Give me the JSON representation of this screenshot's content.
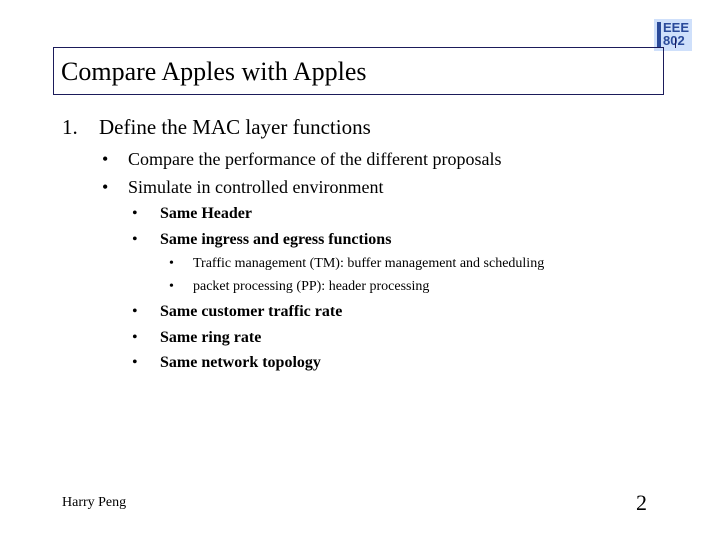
{
  "logo": {
    "line1": "EEE",
    "line2": "802",
    "color": "#2a4a9a",
    "background": "#cfe0fb"
  },
  "title": "Compare Apples with Apples",
  "outline": {
    "number": "1.",
    "heading": "Define the MAC layer functions",
    "bullets": [
      {
        "text": "Compare the performance of the different proposals"
      },
      {
        "text": "Simulate in controlled environment"
      }
    ],
    "sub_bullets": [
      {
        "text": "Same Header"
      },
      {
        "text": "Same ingress and egress functions"
      }
    ],
    "sub_sub_bullets": [
      {
        "text": "Traffic management (TM): buffer management and scheduling"
      },
      {
        "text": "packet processing (PP): header processing"
      }
    ],
    "sub_bullets_after": [
      {
        "text": "Same customer traffic rate"
      },
      {
        "text": "Same ring rate"
      },
      {
        "text": "Same network topology"
      }
    ],
    "bullet_glyph": "•"
  },
  "footer": {
    "author": "Harry Peng",
    "page_number": "2"
  }
}
